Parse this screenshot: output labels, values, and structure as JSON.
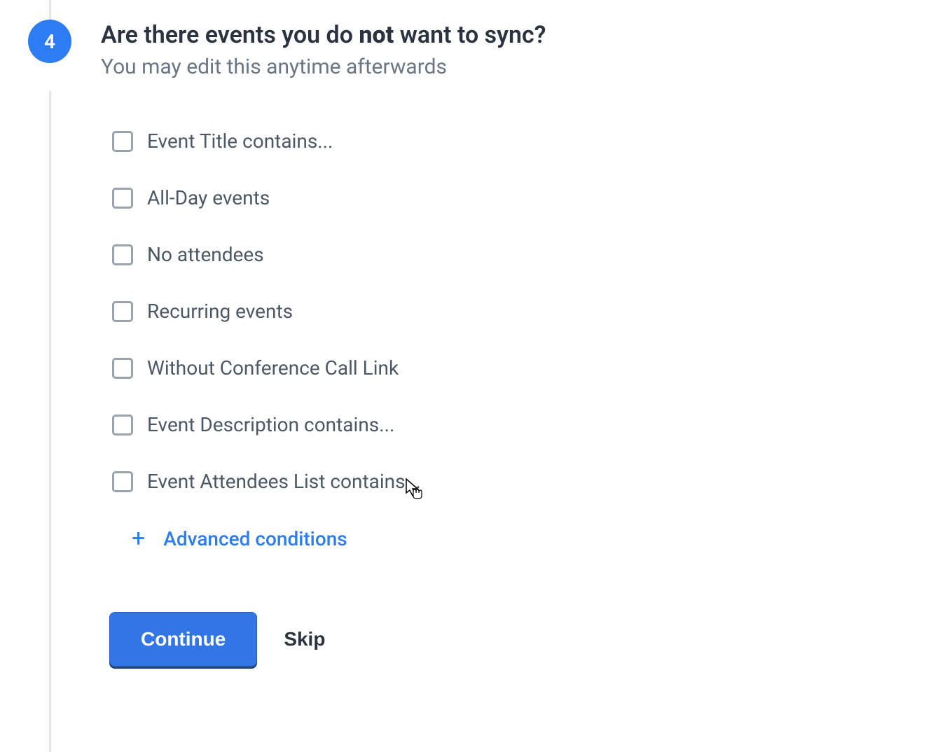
{
  "step": {
    "number": "4",
    "title_before": "Are there events you do ",
    "title_bold": "not",
    "title_after": " want to sync?",
    "subtitle": "You may edit this anytime afterwards"
  },
  "options": [
    {
      "label": "Event Title contains..."
    },
    {
      "label": "All-Day events"
    },
    {
      "label": "No attendees"
    },
    {
      "label": "Recurring events"
    },
    {
      "label": "Without Conference Call Link"
    },
    {
      "label": "Event Description contains..."
    },
    {
      "label": "Event Attendees List contains..."
    }
  ],
  "advanced_label": "Advanced conditions",
  "buttons": {
    "continue": "Continue",
    "skip": "Skip"
  }
}
